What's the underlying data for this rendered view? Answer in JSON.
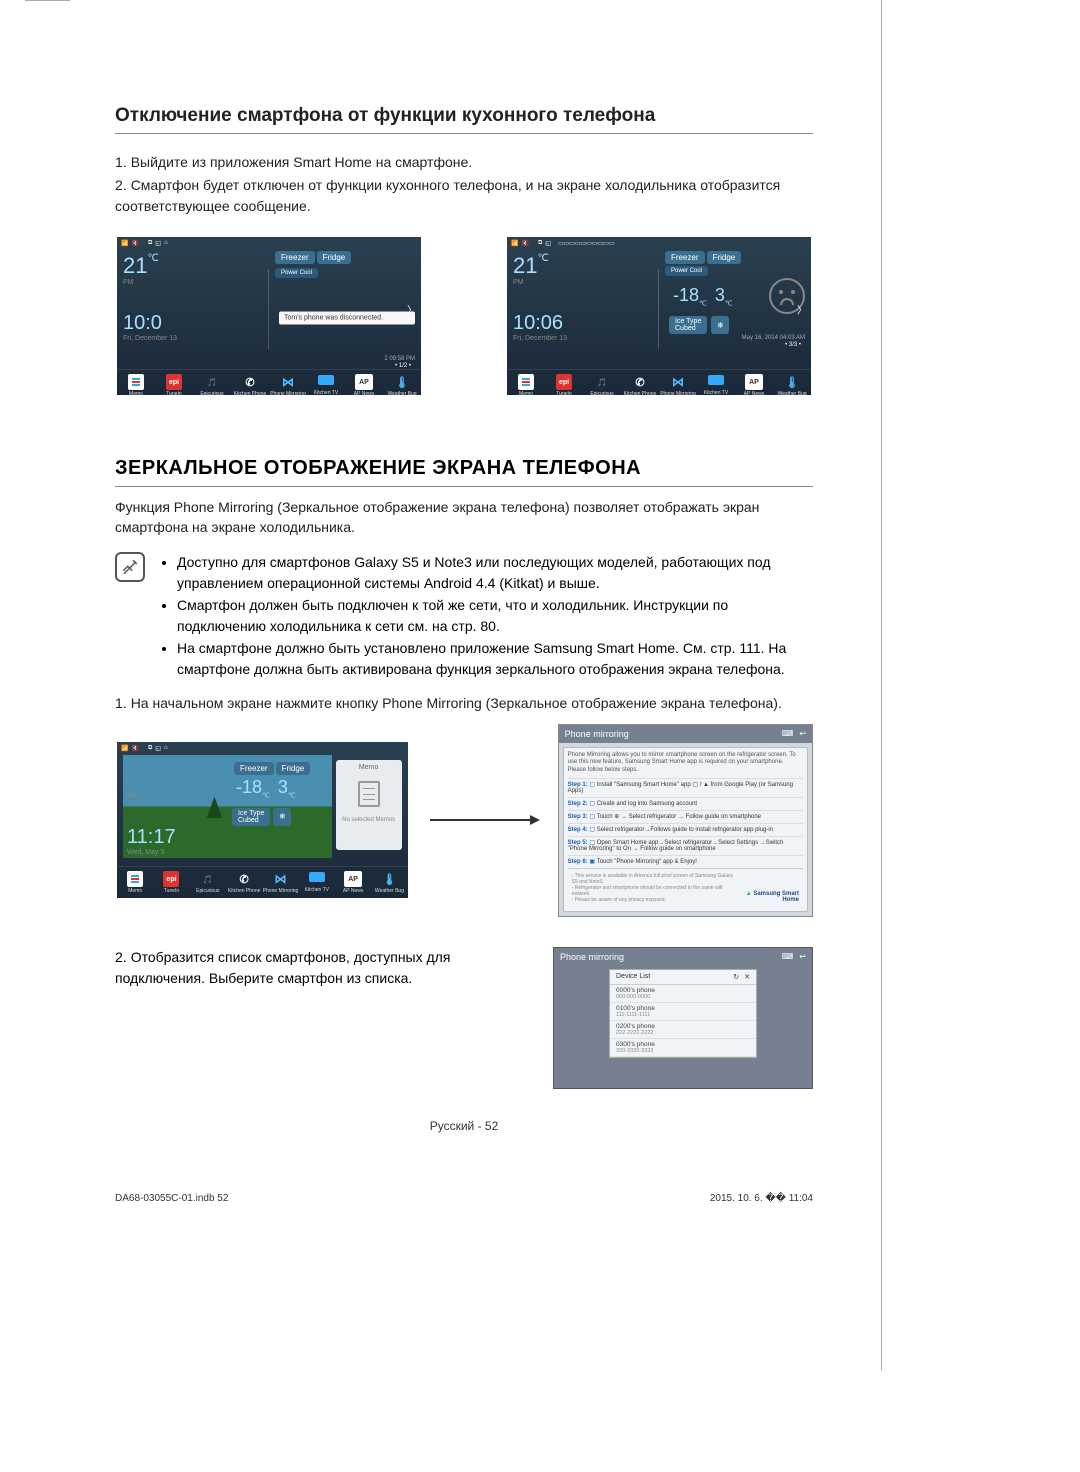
{
  "section1": {
    "title": "Отключение смартфона от функции кухонного телефона",
    "steps": [
      "Выйдите из приложения Smart Home на смартфоне.",
      "Смартфон будет отключен от функции кухонного телефона, и на экране холодильника отобразится соответствующее сообщение."
    ]
  },
  "fridge_a": {
    "temp": "21",
    "unit": "℃",
    "pm": "PM",
    "time": "10:0",
    "date": "Fri, December 13",
    "freezer": "Freezer",
    "fridge": "Fridge",
    "power": "Power Cool",
    "notification": "Tom's phone was disconnected.",
    "ts_small": "2 09:58 PM",
    "dots": "•   1/2   •"
  },
  "fridge_b": {
    "temp": "21",
    "unit": "℃",
    "pm": "PM",
    "time": "10:06",
    "date": "Fri, December 13",
    "freezer": "Freezer",
    "fridge": "Fridge",
    "power": "Power Cool",
    "freezer_t": "-18",
    "fridge_t": "3",
    "icetype": "Ice Type",
    "cubed": "Cubed",
    "timestamp": "May 16, 2014 04:03 AM",
    "dots": "•   3/3   •"
  },
  "apps": [
    "Memo",
    "TuneIn",
    "Epicurious",
    "Kitchen Phone",
    "Phone Mirroring",
    "Kitchen TV",
    "AP News",
    "Weather Bug"
  ],
  "apps_short": [
    "Memo",
    "TuneIn",
    "Epicurious",
    "Kitchen Phone",
    "Phone Mirroring",
    "Kitchen TV",
    "AP News",
    "Weather Bug"
  ],
  "section2": {
    "title": "ЗЕРКАЛЬНОЕ ОТОБРАЖЕНИЕ ЭКРАНА ТЕЛЕФОНА",
    "intro": "Функция Phone Mirroring (Зеркальное отображение экрана телефона) позволяет отображать экран смартфона на экране холодильника.",
    "bullets": [
      "Доступно для смартфонов Galaxy S5 и Note3 или последующих моделей, работающих под управлением операционной системы Android 4.4 (Kitkat) и выше.",
      "Смартфон должен быть подключен к той же сети, что и холодильник. Инструкции по подключению холодильника к сети см. на стр. 80.",
      "На смартфоне должно быть установлено приложение Samsung Smart Home. См. стр. 111. На смартфоне должна быть активирована функция зеркального отображения экрана телефона."
    ],
    "step1": "На начальном экране нажмите кнопку Phone Mirroring (Зеркальное отображение экрана телефона).",
    "step2": "Отобразится список смартфонов, доступных для подключения. Выберите смартфон из списка."
  },
  "fridge_c": {
    "pm": "PM",
    "time": "11:17",
    "date": "Wed, May 3",
    "freezer": "Freezer",
    "fridge": "Fridge",
    "freezer_t": "-18",
    "fridge_t": "3",
    "icetype": "Ice Type",
    "cubed": "Cubed",
    "memo_title": "Memo",
    "no_memos": "No selected Memos"
  },
  "pm_dialog": {
    "title": "Phone mirroring",
    "intro": "Phone Mirroring allows you to mirror smartphone screen on the refrigerator screen. To use this new feature, Samsung Smart Home app is required on your smartphone. Please follow below steps.",
    "steps": [
      "Install \"Samsung Smart Home\" app ▢ / ▲ from Google Play (or Samsung Apps)",
      "Create and log into Samsung account",
      "Touch ⊕ → Select refrigerator → Follow guide on smartphone",
      "Select refrigerator→Follows guide to install refrigerator app plug-in",
      "Open Smart Home app→Select refrigerator→Select Settings →Switch \"Phone Mirroring\" to On → Follow guide on smartphone",
      "Touch \"Phone Mirroring\" app & Enjoy!"
    ],
    "footnotes": "- This service is available in America full pixel screen of Samsung Galaxy S5 and Note3.\n- Refrigerator and smartphone should be connected to the same wifi network.\n- Please be aware of any privacy exposed.",
    "brand": "Samsung Smart Home"
  },
  "devlist": {
    "title": "Phone mirroring",
    "header": "Device List",
    "devices": [
      {
        "name": "0000's phone",
        "num": "000-000-0000"
      },
      {
        "name": "0100's phone",
        "num": "111-1111-1111"
      },
      {
        "name": "0200's phone",
        "num": "222-2222-2222"
      },
      {
        "name": "0300's phone",
        "num": "333-3333-3333"
      }
    ]
  },
  "footer": {
    "lang": "Русский",
    "page": "52"
  },
  "print": {
    "left": "DA68-03055C-01.indb   52",
    "right": "2015. 10. 6.   �� 11:04"
  }
}
